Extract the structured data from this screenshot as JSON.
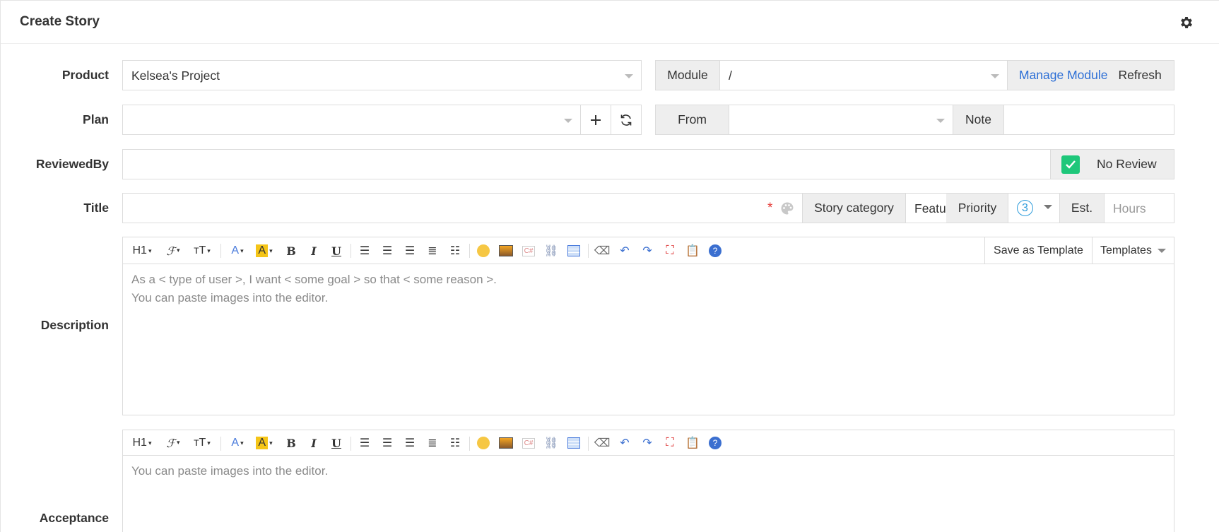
{
  "header": {
    "title": "Create Story",
    "settings_icon": "gear-icon"
  },
  "labels": {
    "product": "Product",
    "plan": "Plan",
    "reviewed_by": "ReviewedBy",
    "title": "Title",
    "description": "Description",
    "acceptance": "Acceptance"
  },
  "product": {
    "value": "Kelsea's Project"
  },
  "module": {
    "label": "Module",
    "value": "/",
    "manage_label": "Manage Module",
    "refresh_label": "Refresh"
  },
  "plan": {
    "value": "",
    "add_icon": "plus-icon",
    "refresh_icon": "refresh-icon"
  },
  "from": {
    "label": "From",
    "value": ""
  },
  "note": {
    "label": "Note",
    "value": ""
  },
  "review": {
    "no_review_label": "No Review",
    "checked": true
  },
  "title_row": {
    "required_mark": "*",
    "story_category_label": "Story category",
    "story_category_value": "Featu",
    "priority_label": "Priority",
    "priority_value": "3",
    "est_label": "Est.",
    "hours_placeholder": "Hours"
  },
  "toolbar": {
    "heading": "H1",
    "font": "ℱ",
    "size": "тT",
    "save_template_label": "Save as Template",
    "templates_label": "Templates"
  },
  "description": {
    "placeholder_line1": "As a < type of user >, I want < some goal > so that < some reason >.",
    "placeholder_line2": "You can paste images into the editor."
  },
  "acceptance": {
    "placeholder": "You can paste images into the editor."
  },
  "colors": {
    "accent": "#2d6fd6",
    "check": "#1ec77a",
    "highlight": "#f5c518",
    "required": "#e53935"
  }
}
